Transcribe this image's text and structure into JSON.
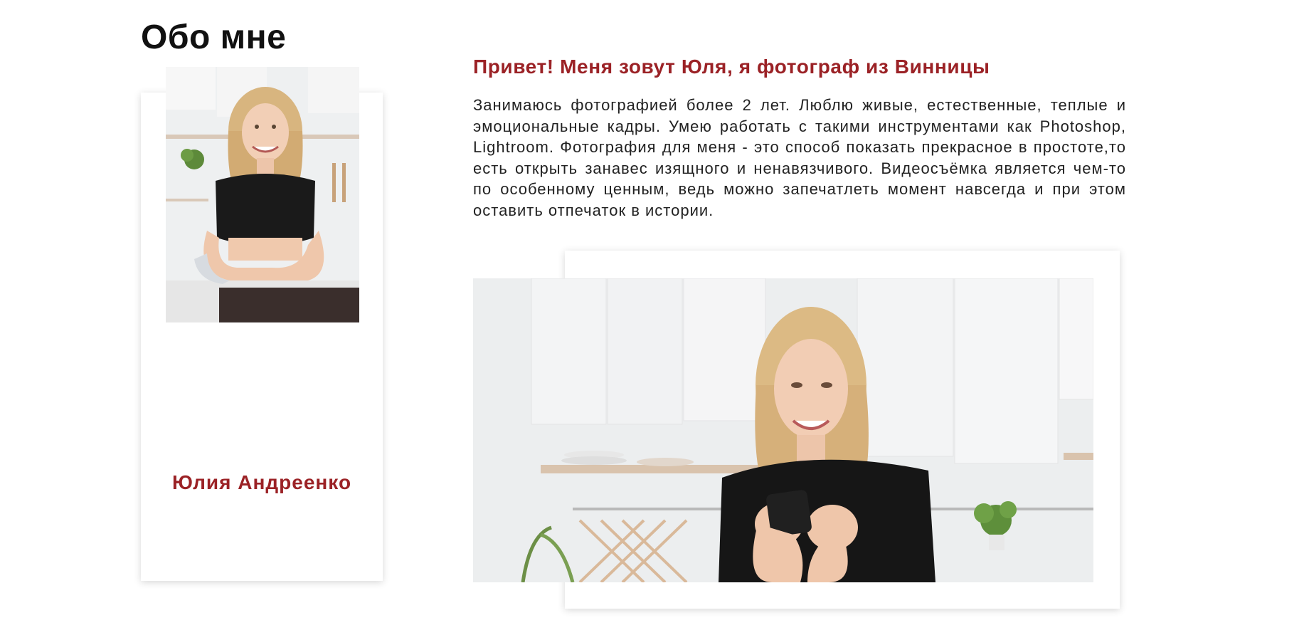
{
  "page": {
    "title": "Обо мне"
  },
  "profile": {
    "name": "Юлия Андреенко",
    "photo_icon": "portrait-photo"
  },
  "about": {
    "greeting": "Привет! Меня зовут Юля, я фотограф из Винницы",
    "bio": "Занимаюсь фотографией более 2 лет. Люблю живые, естественные, теплые и эмоциональные кадры. Умею работать с такими инструментами как Photoshop, Lightroom. Фотография для меня - это способ показать прекрасное в простоте,то есть открыть занавес изящного и ненавязчивого. Видеосъёмка является чем-то по особенному ценным, ведь можно запечатлеть момент навсегда и при этом оставить отпечаток в истории.",
    "photo_icon": "kitchen-photo"
  },
  "colors": {
    "accent": "#9b2226",
    "title": "#111111",
    "text": "#222222",
    "background": "#ffffff"
  }
}
